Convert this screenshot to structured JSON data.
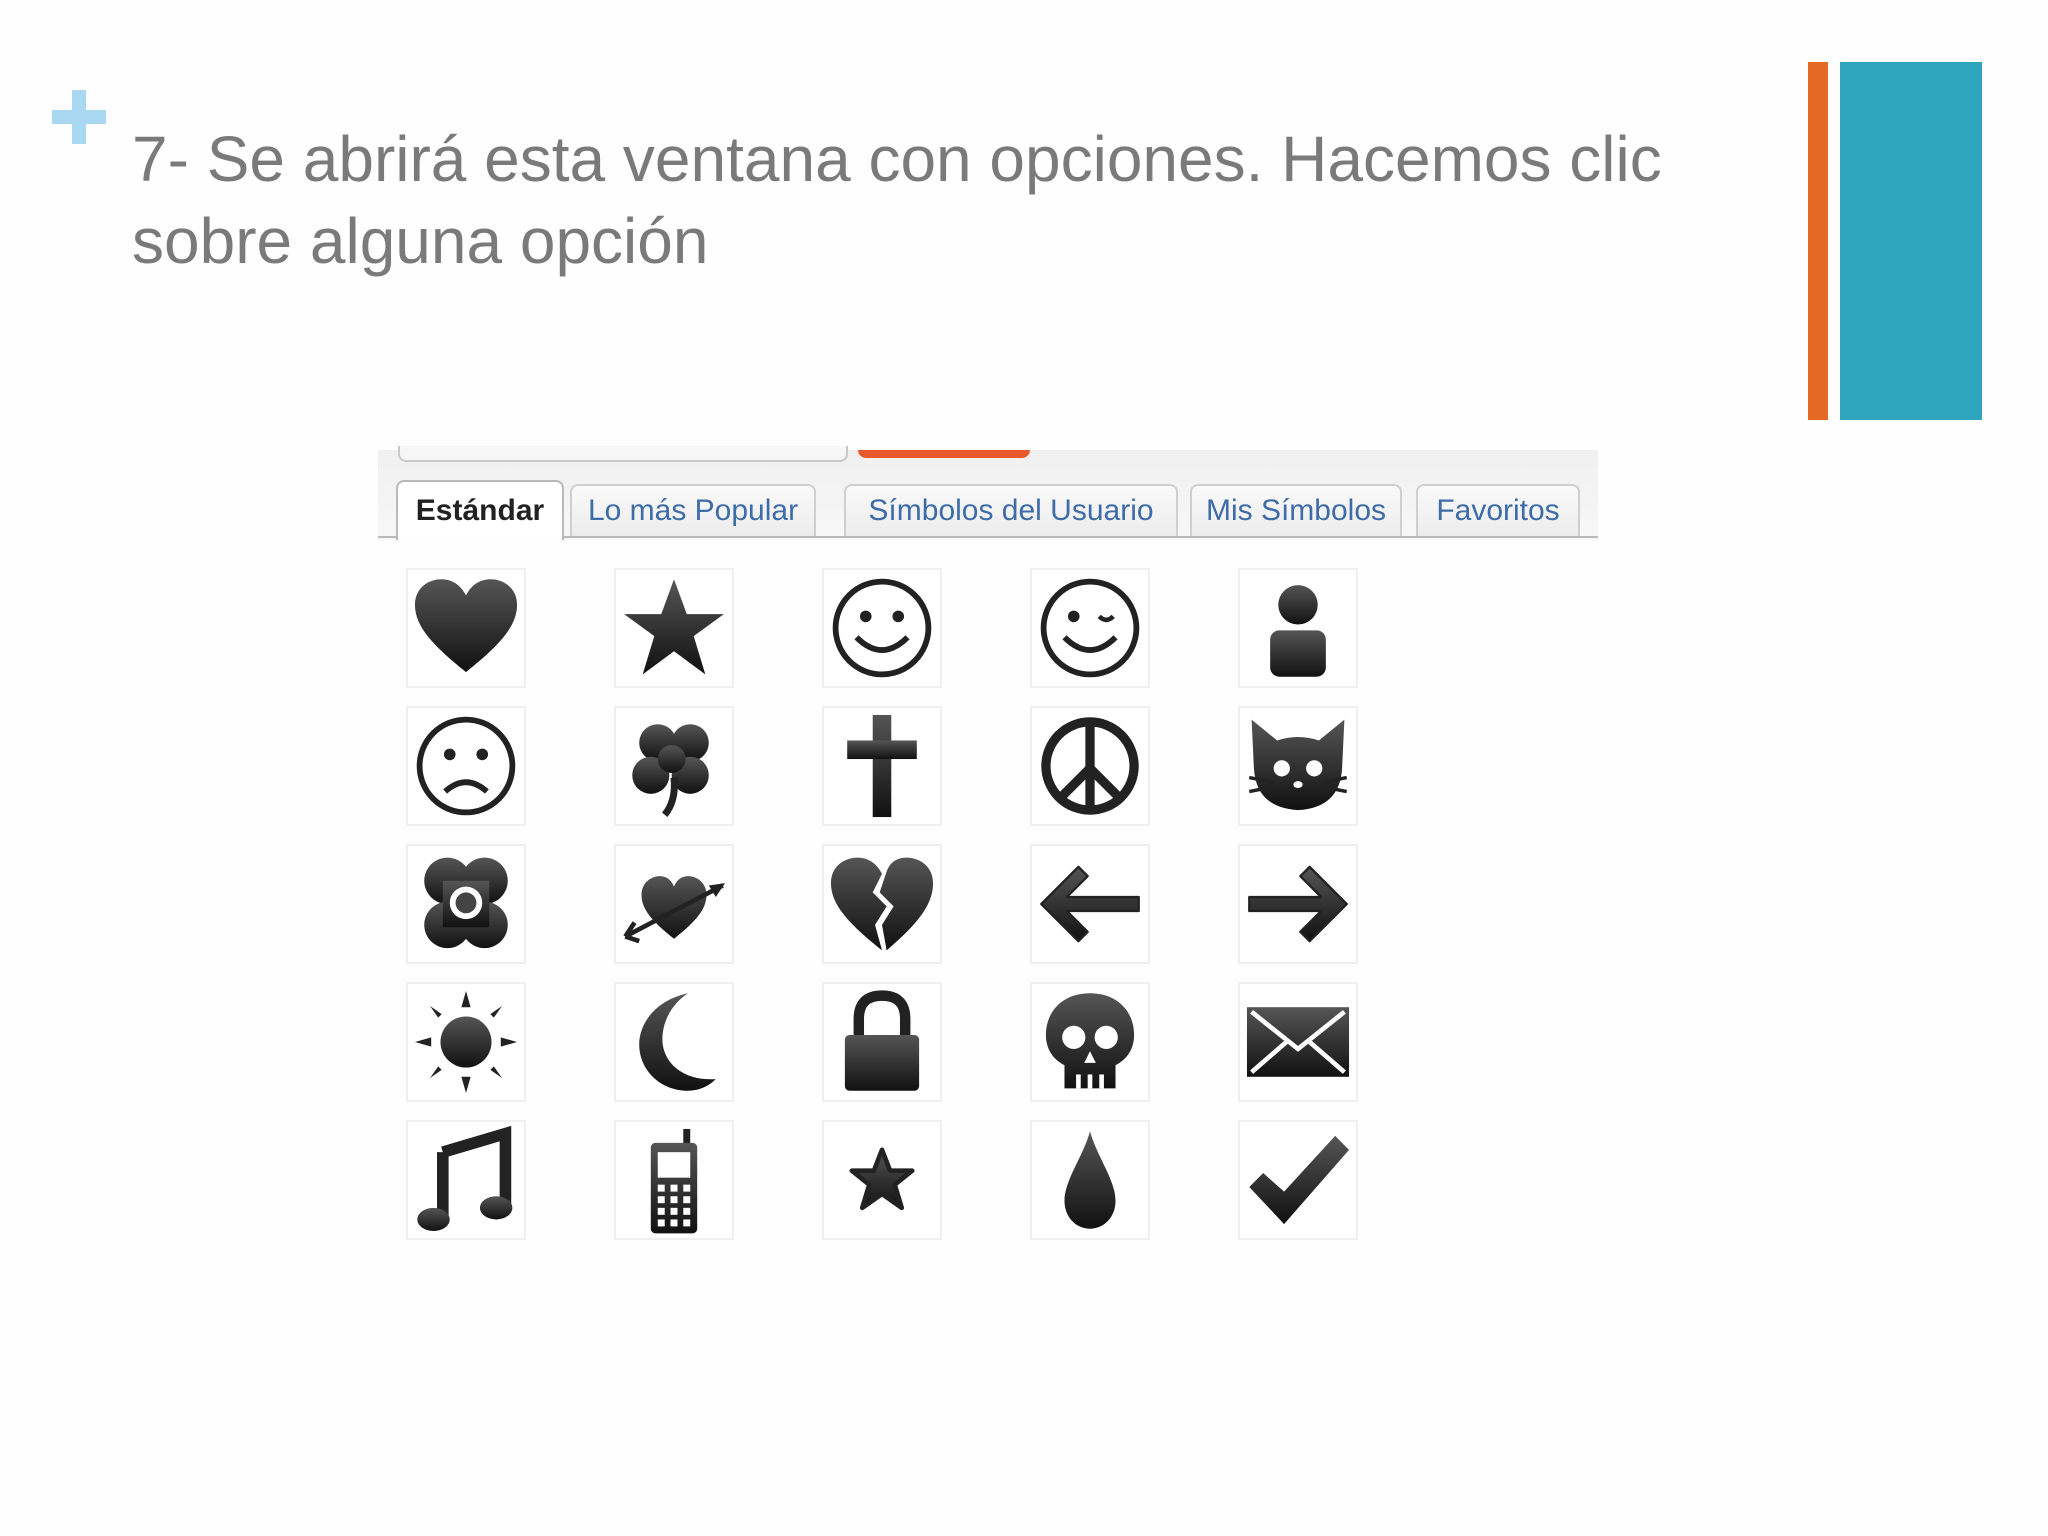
{
  "slide": {
    "title": "7- Se abrirá esta ventana con opciones. Hacemos clic sobre alguna opción",
    "accent_colors": {
      "plus": "#a9d9f2",
      "orange_bar": "#e46a24",
      "teal_bar": "#2ea4bd",
      "text": "#7a7a7a"
    }
  },
  "picker": {
    "tabs": [
      {
        "label": "Estándar",
        "active": true
      },
      {
        "label": "Lo más Popular",
        "active": false
      },
      {
        "label": "Símbolos del Usuario",
        "active": false
      },
      {
        "label": "Mis Símbolos",
        "active": false
      },
      {
        "label": "Favoritos",
        "active": false
      }
    ],
    "symbols": [
      [
        "heart-icon",
        "star-icon",
        "smiley-icon",
        "wink-icon",
        "person-icon"
      ],
      [
        "sad-face-icon",
        "clover-icon",
        "cross-icon",
        "peace-icon",
        "cat-icon"
      ],
      [
        "flower-icon",
        "heart-arrow-icon",
        "broken-heart-icon",
        "arrow-left-icon",
        "arrow-right-icon"
      ],
      [
        "sun-icon",
        "moon-icon",
        "lock-icon",
        "skull-icon",
        "envelope-icon"
      ],
      [
        "music-note-icon",
        "mobile-phone-icon",
        "small-star-icon",
        "drop-icon",
        "checkmark-icon"
      ]
    ]
  }
}
